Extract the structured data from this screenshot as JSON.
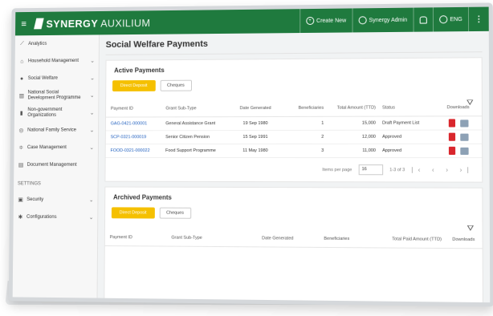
{
  "topbar": {
    "menu_icon": "hamburger-icon",
    "brand_bold": "SYNERGY",
    "brand_light": "AUXILIUM",
    "create_new": "Create New",
    "user": "Synergy Admin",
    "language": "ENG",
    "colors": {
      "bar": "#1f7a3e"
    }
  },
  "sidebar": {
    "items": [
      {
        "icon": "analytics-icon",
        "label": "Analytics",
        "chevron": false
      },
      {
        "icon": "home-icon",
        "label": "Household Management",
        "chevron": true
      },
      {
        "icon": "users-icon",
        "label": "Social Welfare",
        "chevron": true
      },
      {
        "icon": "bank-icon",
        "label": "National Social Development Programme",
        "chevron": true
      },
      {
        "icon": "building-icon",
        "label": "Non-government Organizations",
        "chevron": true
      },
      {
        "icon": "support-icon",
        "label": "National Family Service",
        "chevron": true
      },
      {
        "icon": "case-icon",
        "label": "Case Management",
        "chevron": true
      },
      {
        "icon": "document-icon",
        "label": "Document Management",
        "chevron": false
      }
    ],
    "settings_heading": "SETTINGS",
    "settings_items": [
      {
        "icon": "lock-icon",
        "label": "Security",
        "chevron": true
      },
      {
        "icon": "gear-icon",
        "label": "Configurations",
        "chevron": true
      }
    ]
  },
  "main": {
    "title": "Social Welfare Payments",
    "active": {
      "heading": "Active Payments",
      "tab_direct": "Direct Deposit",
      "tab_cheques": "Cheques",
      "columns": [
        "Payment ID",
        "Grant Sub-Type",
        "Date Generated",
        "Beneficiaries",
        "Total Amount (TTD)",
        "Status",
        "Downloads"
      ],
      "rows": [
        {
          "id": "GAG-0421-000001",
          "type": "General Assistance Grant",
          "date": "19 Sep 1980",
          "beneficiaries": "1",
          "amount": "15,000",
          "status": "Draft Payment List"
        },
        {
          "id": "SCP-0321-000019",
          "type": "Senior Citizen Pension",
          "date": "15 Sep 1991",
          "beneficiaries": "2",
          "amount": "12,000",
          "status": "Approved"
        },
        {
          "id": "FOOD-0321-000022",
          "type": "Food Support Programme",
          "date": "11 May 1980",
          "beneficiaries": "3",
          "amount": "11,000",
          "status": "Approved"
        }
      ],
      "items_per_page_label": "Items per page",
      "items_per_page": "16",
      "range": "1-3 of 3"
    },
    "archived": {
      "heading": "Archived Payments",
      "tab_direct": "Direct Deposit",
      "tab_cheques": "Cheques",
      "columns": [
        "Payment ID",
        "Grant Sub-Type",
        "Date Generated",
        "Beneficiaries",
        "Total Paid Amount (TTD)",
        "Downloads"
      ]
    }
  }
}
